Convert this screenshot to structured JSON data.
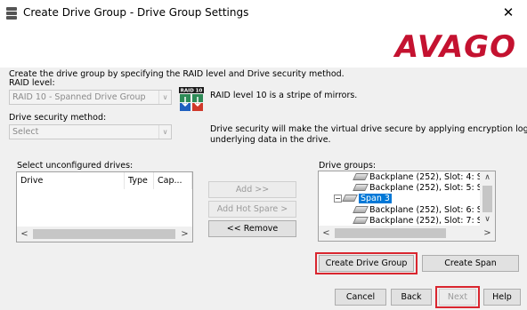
{
  "window": {
    "title": "Create Drive Group - Drive Group Settings",
    "close_label": "✕"
  },
  "brand": {
    "logo_text": "AVAGO",
    "logo_color": "#c41230"
  },
  "intro_text": "Create the drive group by specifying the RAID level and Drive security method.",
  "raid": {
    "label": "RAID level:",
    "selected": "RAID 10 - Spanned Drive Group",
    "icon_text": "RAID 10",
    "description": "RAID level 10 is a stripe of mirrors."
  },
  "security": {
    "label": "Drive security method:",
    "selected": "Select",
    "description_line1": "Drive security will make the virtual drive secure by applying encryption logic to",
    "description_line2": "underlying data in the drive."
  },
  "unconfigured": {
    "label": "Select unconfigured drives:",
    "columns": [
      "Drive",
      "Type",
      "Cap..."
    ]
  },
  "middle_buttons": {
    "add": "Add >>",
    "add_hot_spare": "Add Hot Spare >",
    "remove": "<< Remove"
  },
  "drive_groups": {
    "label": "Drive groups:",
    "rows": [
      "Backplane (252), Slot: 4: S",
      "Backplane (252), Slot: 5: S",
      "Span 3",
      "Backplane (252), Slot: 6: S",
      "Backplane (252), Slot: 7: S"
    ]
  },
  "group_buttons": {
    "create_drive_group": "Create Drive Group",
    "create_span": "Create Span"
  },
  "footer": {
    "cancel": "Cancel",
    "back": "Back",
    "next": "Next",
    "help": "Help"
  },
  "highlight_color": "#d9262f",
  "icons": {
    "app": "disk-stack-icon",
    "raid": "raid-10-icon",
    "drive": "hard-drive-icon"
  }
}
